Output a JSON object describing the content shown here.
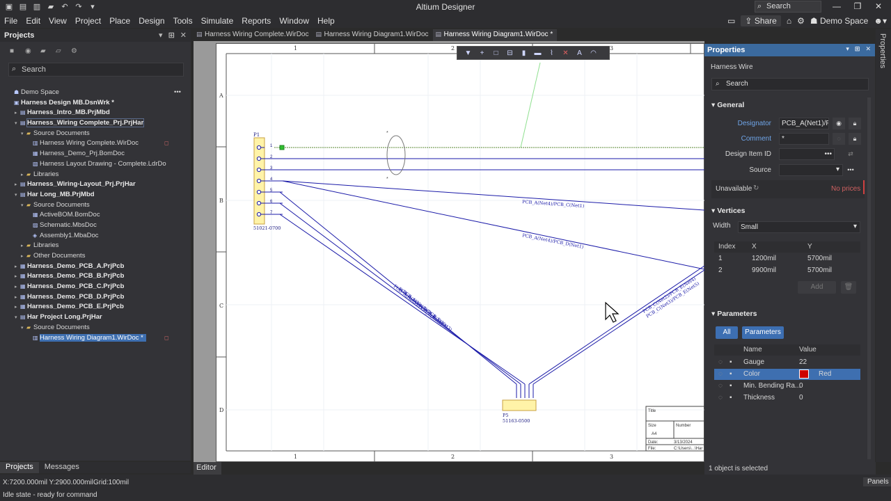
{
  "window": {
    "title": "Altium Designer",
    "search_placeholder": "Search",
    "minimize": "—",
    "maximize": "❐",
    "close": "✕"
  },
  "menu": {
    "items": [
      "File",
      "Edit",
      "View",
      "Project",
      "Place",
      "Design",
      "Tools",
      "Simulate",
      "Reports",
      "Window",
      "Help"
    ],
    "share_label": "Share",
    "workspace_label": "Demo Space"
  },
  "projects_panel": {
    "title": "Projects",
    "search_placeholder": "Search",
    "tree": [
      {
        "label": "Demo Space",
        "level": 0,
        "bold": false,
        "icon": "workspace-icon",
        "twisty": ""
      },
      {
        "label": "Harness Design MB.DsnWrk *",
        "level": 0,
        "bold": true,
        "icon": "workspace-file-icon",
        "twisty": ""
      },
      {
        "label": "Harness_Intro_MB.PrjMbd",
        "level": 1,
        "bold": true,
        "icon": "project-icon",
        "twisty": "▸"
      },
      {
        "label": "Harness_Wiring Complete_Prj.PrjHar",
        "level": 1,
        "bold": true,
        "icon": "project-icon",
        "twisty": "▾",
        "outline": true
      },
      {
        "label": "Source Documents",
        "level": 2,
        "bold": false,
        "icon": "folder-icon",
        "twisty": "▾"
      },
      {
        "label": "Harness Wiring Complete.WirDoc",
        "level": 3,
        "bold": false,
        "icon": "wiring-doc-icon",
        "twisty": "",
        "mark": true
      },
      {
        "label": "Harness_Demo_Prj.BomDoc",
        "level": 3,
        "bold": false,
        "icon": "bom-doc-icon",
        "twisty": ""
      },
      {
        "label": "Harness Layout Drawing - Complete.LdrDo",
        "level": 3,
        "bold": false,
        "icon": "layout-doc-icon",
        "twisty": ""
      },
      {
        "label": "Libraries",
        "level": 2,
        "bold": false,
        "icon": "folder-icon",
        "twisty": "▸"
      },
      {
        "label": "Harness_Wiring-Layout_Prj.PrjHar",
        "level": 1,
        "bold": true,
        "icon": "project-icon",
        "twisty": "▸"
      },
      {
        "label": "Har Long_MB.PrjMbd",
        "level": 1,
        "bold": true,
        "icon": "project-icon",
        "twisty": "▾"
      },
      {
        "label": "Source Documents",
        "level": 2,
        "bold": false,
        "icon": "folder-icon",
        "twisty": "▾"
      },
      {
        "label": "ActiveBOM.BomDoc",
        "level": 3,
        "bold": false,
        "icon": "bom-doc-icon",
        "twisty": ""
      },
      {
        "label": "Schematic.MbsDoc",
        "level": 3,
        "bold": false,
        "icon": "schematic-doc-icon",
        "twisty": ""
      },
      {
        "label": "Assembly1.MbaDoc",
        "level": 3,
        "bold": false,
        "icon": "assembly-doc-icon",
        "twisty": ""
      },
      {
        "label": "Libraries",
        "level": 2,
        "bold": false,
        "icon": "folder-icon",
        "twisty": "▸"
      },
      {
        "label": "Other Documents",
        "level": 2,
        "bold": false,
        "icon": "folder-icon",
        "twisty": "▸"
      },
      {
        "label": "Harness_Demo_PCB_A.PrjPcb",
        "level": 1,
        "bold": true,
        "icon": "pcb-project-icon",
        "twisty": "▸"
      },
      {
        "label": "Harness_Demo_PCB_B.PrjPcb",
        "level": 1,
        "bold": true,
        "icon": "pcb-project-icon",
        "twisty": "▸"
      },
      {
        "label": "Harness_Demo_PCB_C.PrjPcb",
        "level": 1,
        "bold": true,
        "icon": "pcb-project-icon",
        "twisty": "▸"
      },
      {
        "label": "Harness_Demo_PCB_D.PrjPcb",
        "level": 1,
        "bold": true,
        "icon": "pcb-project-icon",
        "twisty": "▸"
      },
      {
        "label": "Harness_Demo_PCB_E.PrjPcb",
        "level": 1,
        "bold": true,
        "icon": "pcb-project-icon",
        "twisty": "▸"
      },
      {
        "label": "Har Project Long.PrjHar",
        "level": 1,
        "bold": true,
        "icon": "project-icon",
        "twisty": "▾"
      },
      {
        "label": "Source Documents",
        "level": 2,
        "bold": false,
        "icon": "folder-icon",
        "twisty": "▾"
      },
      {
        "label": "Harness Wiring Diagram1.WirDoc *",
        "level": 3,
        "bold": false,
        "icon": "wiring-doc-icon",
        "twisty": "",
        "selected": true,
        "mark": true
      }
    ],
    "bottom_tabs": [
      "Projects",
      "Messages"
    ]
  },
  "doc_tabs": [
    "Harness Wiring Complete.WirDoc",
    "Harness Wiring Diagram1.WirDoc",
    "Harness Wiring Diagram1.WirDoc *"
  ],
  "editor": {
    "tab_label": "Editor",
    "col_labels": [
      "1",
      "2",
      "3"
    ],
    "row_labels": [
      "A",
      "B",
      "C",
      "D"
    ],
    "connector_p1": {
      "designator": "P1",
      "part": "51021-0700",
      "pins": [
        "1",
        "2",
        "3",
        "4",
        "5",
        "6",
        "7"
      ]
    },
    "connector_p5": {
      "designator": "P5",
      "part": "51163-0500"
    },
    "wire_labels": [
      "PCB_A(Net4)/PCB_C(Net1)",
      "PCB_A(Net4)/PCB_D(Net1)",
      "PCB_C(Net2)/PCB_E(Net4)",
      "PCB_C(Net3)/PCB_E(Net5)",
      "PCB_A(Net5)/PCB_E(Net1)",
      "PCB_A(Net6)/PCB_E(Net2)",
      "PCB_A(Net7)/PCB_E(Net3)"
    ],
    "bundle_marks": [
      "*",
      "*"
    ],
    "title_block": {
      "title": "Title",
      "size": "Size",
      "size_value": "A4",
      "number": "Number",
      "date": "Date:",
      "date_value": "3/13/2024",
      "file": "File:",
      "file_value": "C:\\Users\\...\\Har"
    }
  },
  "properties": {
    "title": "Properties",
    "object_type": "Harness Wire",
    "search_placeholder": "Search",
    "general": {
      "title": "General",
      "designator_label": "Designator",
      "designator_value": "PCB_A(Net1)/PC",
      "comment_label": "Comment",
      "comment_value": "*",
      "design_item_label": "Design Item ID",
      "design_item_value": "•••",
      "source_label": "Source",
      "unavailable_label": "Unavailable",
      "no_prices": "No prices"
    },
    "vertices": {
      "title": "Vertices",
      "width_label": "Width",
      "width_value": "Small",
      "columns": [
        "Index",
        "X",
        "Y"
      ],
      "rows": [
        [
          "1",
          "1200mil",
          "5700mil"
        ],
        [
          "2",
          "9900mil",
          "5700mil"
        ]
      ],
      "add_label": "Add"
    },
    "parameters": {
      "title": "Parameters",
      "filter_all": "All",
      "filter_params": "Parameters",
      "columns": [
        "Name",
        "Value"
      ],
      "rows": [
        {
          "name": "Gauge",
          "value": "22",
          "selected": false
        },
        {
          "name": "Color",
          "value": "Red",
          "selected": true,
          "swatch": "#cc0000"
        },
        {
          "name": "Min. Bending Ra...",
          "value": "0",
          "selected": false
        },
        {
          "name": "Thickness",
          "value": "0",
          "selected": false
        }
      ]
    },
    "footer": "1 object is selected"
  },
  "right_strip_label": "Properties",
  "status": {
    "coords": "X:7200.000mil Y:2900.000mil",
    "grid": "Grid:100mil",
    "state": "Idle state - ready for command",
    "panels_label": "Panels"
  },
  "colors": {
    "accent": "#3b6a9e",
    "wire": "#1a1aa8",
    "selection": "#3e6fb0"
  }
}
